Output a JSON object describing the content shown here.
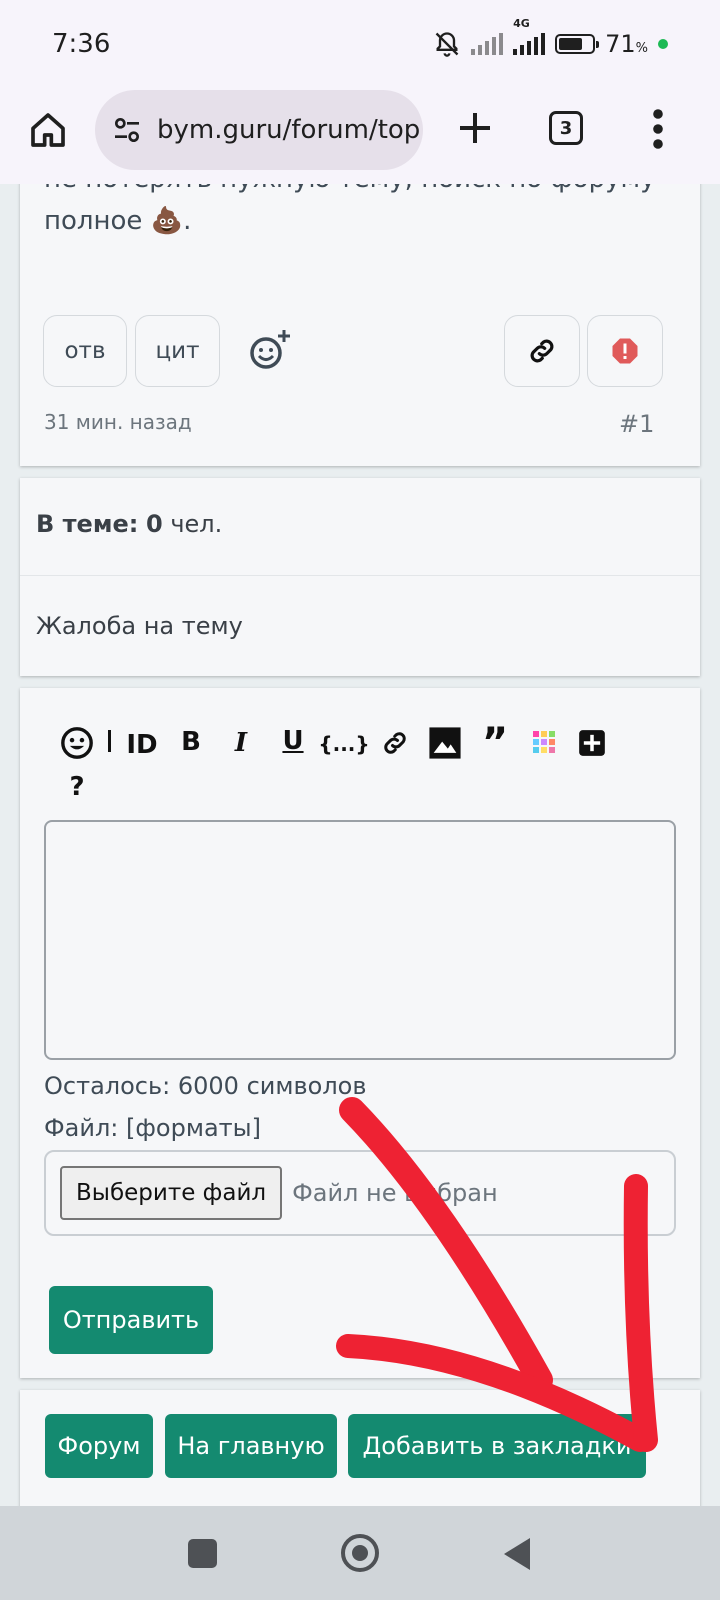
{
  "status": {
    "time": "7:36",
    "network": "4G",
    "battery": "71",
    "battery_unit": "%",
    "battery_level": 0.71
  },
  "browser": {
    "url": "bym.guru/forum/top",
    "tab_count": "3"
  },
  "post": {
    "text_line1": "не потерять нужную тему, поиск по форуму",
    "text_line2": "полное 💩.",
    "reply_label": "отв",
    "quote_label": "цит",
    "time_ago": "31 мин. назад",
    "number": "#1"
  },
  "topic_info": {
    "in_topic_label": "В теме:",
    "in_topic_count": "0",
    "in_topic_unit": "чел.",
    "complaint_label": "Жалоба на тему"
  },
  "editor": {
    "toolbar": {
      "id_label": "ID",
      "bold_label": "B",
      "italic_label": "I",
      "underline_label": "U",
      "code_label": "{...}",
      "quote_label": "”",
      "help_label": "?"
    },
    "remaining_prefix": "Осталось:",
    "remaining_count": "6000",
    "remaining_suffix": "символов",
    "file_label": "Файл:",
    "formats_link": "[форматы]",
    "choose_file": "Выберите файл",
    "no_file": "Файл не выбран",
    "send_button": "Отправить"
  },
  "footer_nav": {
    "forum": "Форум",
    "home": "На главную",
    "bookmark": "Добавить в закладки"
  },
  "colors": {
    "accent": "#148a70",
    "annotation": "#ee2233"
  }
}
